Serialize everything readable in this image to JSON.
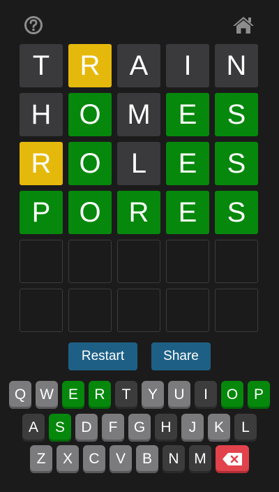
{
  "header": {
    "help_icon": "question-circle-icon",
    "home_icon": "home-icon"
  },
  "colors": {
    "background": "#1b1b1b",
    "absent": "#3a3a3c",
    "present": "#e5b90c",
    "correct": "#05880b",
    "unused_key": "#7b7b7d",
    "button": "#1e6085",
    "delete_key": "#e1424c"
  },
  "board": {
    "rows": [
      [
        {
          "letter": "T",
          "state": "absent"
        },
        {
          "letter": "R",
          "state": "present"
        },
        {
          "letter": "A",
          "state": "absent"
        },
        {
          "letter": "I",
          "state": "absent"
        },
        {
          "letter": "N",
          "state": "absent"
        }
      ],
      [
        {
          "letter": "H",
          "state": "absent"
        },
        {
          "letter": "O",
          "state": "correct"
        },
        {
          "letter": "M",
          "state": "absent"
        },
        {
          "letter": "E",
          "state": "correct"
        },
        {
          "letter": "S",
          "state": "correct"
        }
      ],
      [
        {
          "letter": "R",
          "state": "present"
        },
        {
          "letter": "O",
          "state": "correct"
        },
        {
          "letter": "L",
          "state": "absent"
        },
        {
          "letter": "E",
          "state": "correct"
        },
        {
          "letter": "S",
          "state": "correct"
        }
      ],
      [
        {
          "letter": "P",
          "state": "correct"
        },
        {
          "letter": "O",
          "state": "correct"
        },
        {
          "letter": "R",
          "state": "correct"
        },
        {
          "letter": "E",
          "state": "correct"
        },
        {
          "letter": "S",
          "state": "correct"
        }
      ],
      [
        {
          "letter": "",
          "state": "empty"
        },
        {
          "letter": "",
          "state": "empty"
        },
        {
          "letter": "",
          "state": "empty"
        },
        {
          "letter": "",
          "state": "empty"
        },
        {
          "letter": "",
          "state": "empty"
        }
      ],
      [
        {
          "letter": "",
          "state": "empty"
        },
        {
          "letter": "",
          "state": "empty"
        },
        {
          "letter": "",
          "state": "empty"
        },
        {
          "letter": "",
          "state": "empty"
        },
        {
          "letter": "",
          "state": "empty"
        }
      ]
    ]
  },
  "actions": {
    "restart_label": "Restart",
    "share_label": "Share"
  },
  "keyboard": {
    "rows": [
      [
        {
          "label": "Q",
          "state": "unused"
        },
        {
          "label": "W",
          "state": "unused"
        },
        {
          "label": "E",
          "state": "correct"
        },
        {
          "label": "R",
          "state": "correct"
        },
        {
          "label": "T",
          "state": "absent"
        },
        {
          "label": "Y",
          "state": "unused"
        },
        {
          "label": "U",
          "state": "unused"
        },
        {
          "label": "I",
          "state": "absent"
        },
        {
          "label": "O",
          "state": "correct"
        },
        {
          "label": "P",
          "state": "correct"
        }
      ],
      [
        {
          "label": "A",
          "state": "absent"
        },
        {
          "label": "S",
          "state": "correct"
        },
        {
          "label": "D",
          "state": "unused"
        },
        {
          "label": "F",
          "state": "unused"
        },
        {
          "label": "G",
          "state": "unused"
        },
        {
          "label": "H",
          "state": "absent"
        },
        {
          "label": "J",
          "state": "unused"
        },
        {
          "label": "K",
          "state": "unused"
        },
        {
          "label": "L",
          "state": "absent"
        }
      ],
      [
        {
          "label": "Z",
          "state": "unused"
        },
        {
          "label": "X",
          "state": "unused"
        },
        {
          "label": "C",
          "state": "unused"
        },
        {
          "label": "V",
          "state": "unused"
        },
        {
          "label": "B",
          "state": "unused"
        },
        {
          "label": "N",
          "state": "absent"
        },
        {
          "label": "M",
          "state": "absent"
        },
        {
          "label": "",
          "state": "delete",
          "icon": "backspace-icon"
        }
      ]
    ]
  }
}
